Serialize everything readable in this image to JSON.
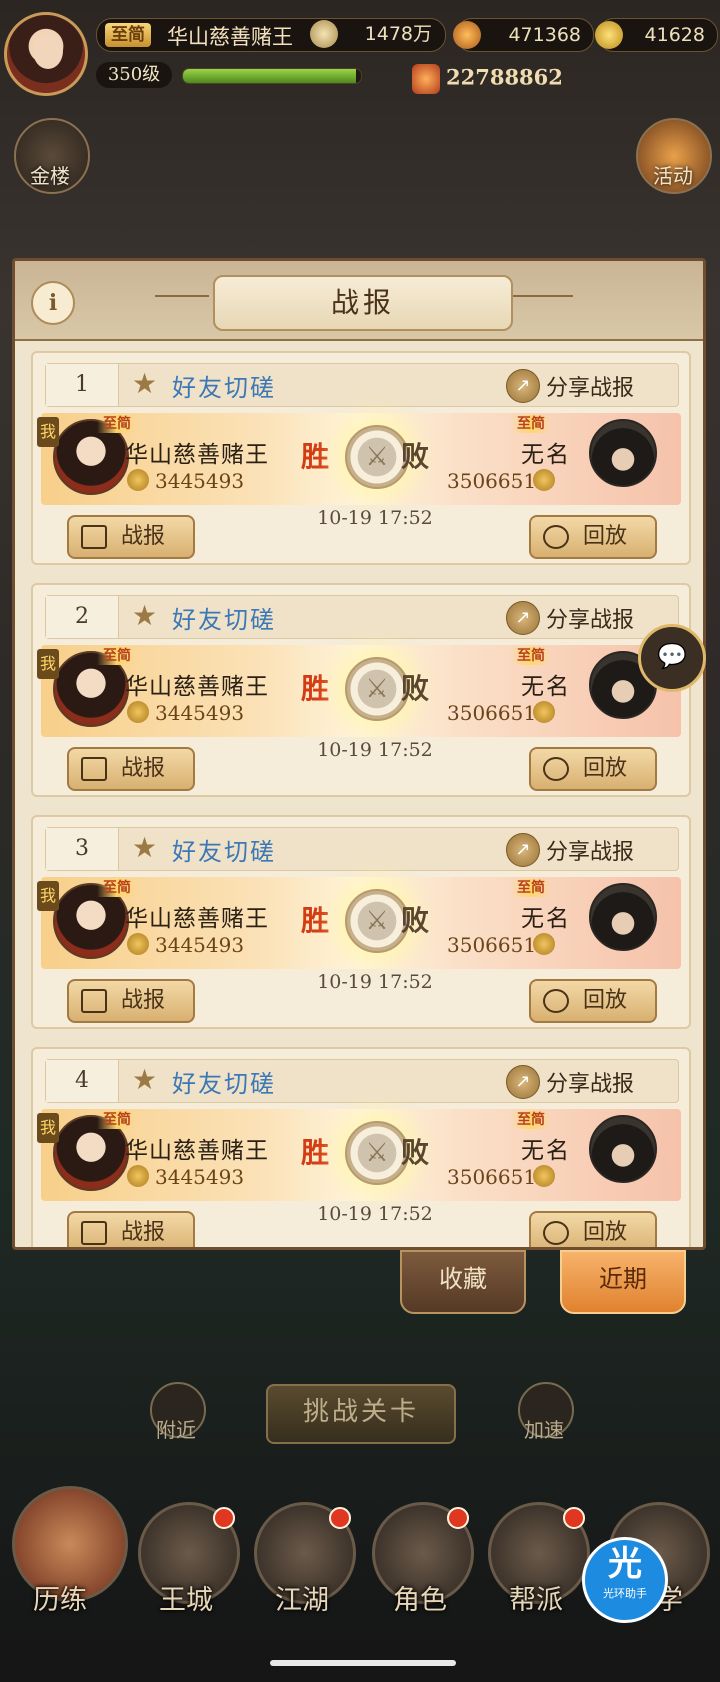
{
  "top": {
    "vip": "至简",
    "player_name": "华山慈善赌王",
    "level": "350级",
    "exp_fraction": 0.97,
    "silver": "1478万",
    "gold_a": "471368",
    "gold_b": "41628",
    "power": "22788862",
    "left_btn": "金楼",
    "right_btn": "活动"
  },
  "panel": {
    "title": "战报",
    "info": "i"
  },
  "entries": [
    {
      "index": "1",
      "mode": "好友切磋",
      "share": "分享战报",
      "vip_left": "至简",
      "vip_right": "至简",
      "me": "我",
      "left_name": "华山慈善赌王",
      "left_power": "3445493",
      "win": "胜",
      "lose": "败",
      "right_name": "无名",
      "right_power": "3506651",
      "time": "10-19 17:52",
      "btn_report": "战报",
      "btn_replay": "回放"
    },
    {
      "index": "2",
      "mode": "好友切磋",
      "share": "分享战报",
      "vip_left": "至简",
      "vip_right": "至简",
      "me": "我",
      "left_name": "华山慈善赌王",
      "left_power": "3445493",
      "win": "胜",
      "lose": "败",
      "right_name": "无名",
      "right_power": "3506651",
      "time": "10-19 17:52",
      "btn_report": "战报",
      "btn_replay": "回放"
    },
    {
      "index": "3",
      "mode": "好友切磋",
      "share": "分享战报",
      "vip_left": "至简",
      "vip_right": "至简",
      "me": "我",
      "left_name": "华山慈善赌王",
      "left_power": "3445493",
      "win": "胜",
      "lose": "败",
      "right_name": "无名",
      "right_power": "3506651",
      "time": "10-19 17:52",
      "btn_report": "战报",
      "btn_replay": "回放"
    },
    {
      "index": "4",
      "mode": "好友切磋",
      "share": "分享战报",
      "vip_left": "至简",
      "vip_right": "至简",
      "me": "我",
      "left_name": "华山慈善赌王",
      "left_power": "3445493",
      "win": "胜",
      "lose": "败",
      "right_name": "无名",
      "right_power": "3506651",
      "time": "10-19 17:52",
      "btn_report": "战报",
      "btn_replay": "回放"
    }
  ],
  "tabs": {
    "favorites": "收藏",
    "recent": "近期"
  },
  "challenge": "挑战关卡",
  "nearby": "附近",
  "speedup": "加速",
  "bottom_nav": [
    "历练",
    "王城",
    "江湖",
    "角色",
    "帮派",
    "武学"
  ],
  "helper": {
    "char": "光",
    "text": "光环助手"
  }
}
